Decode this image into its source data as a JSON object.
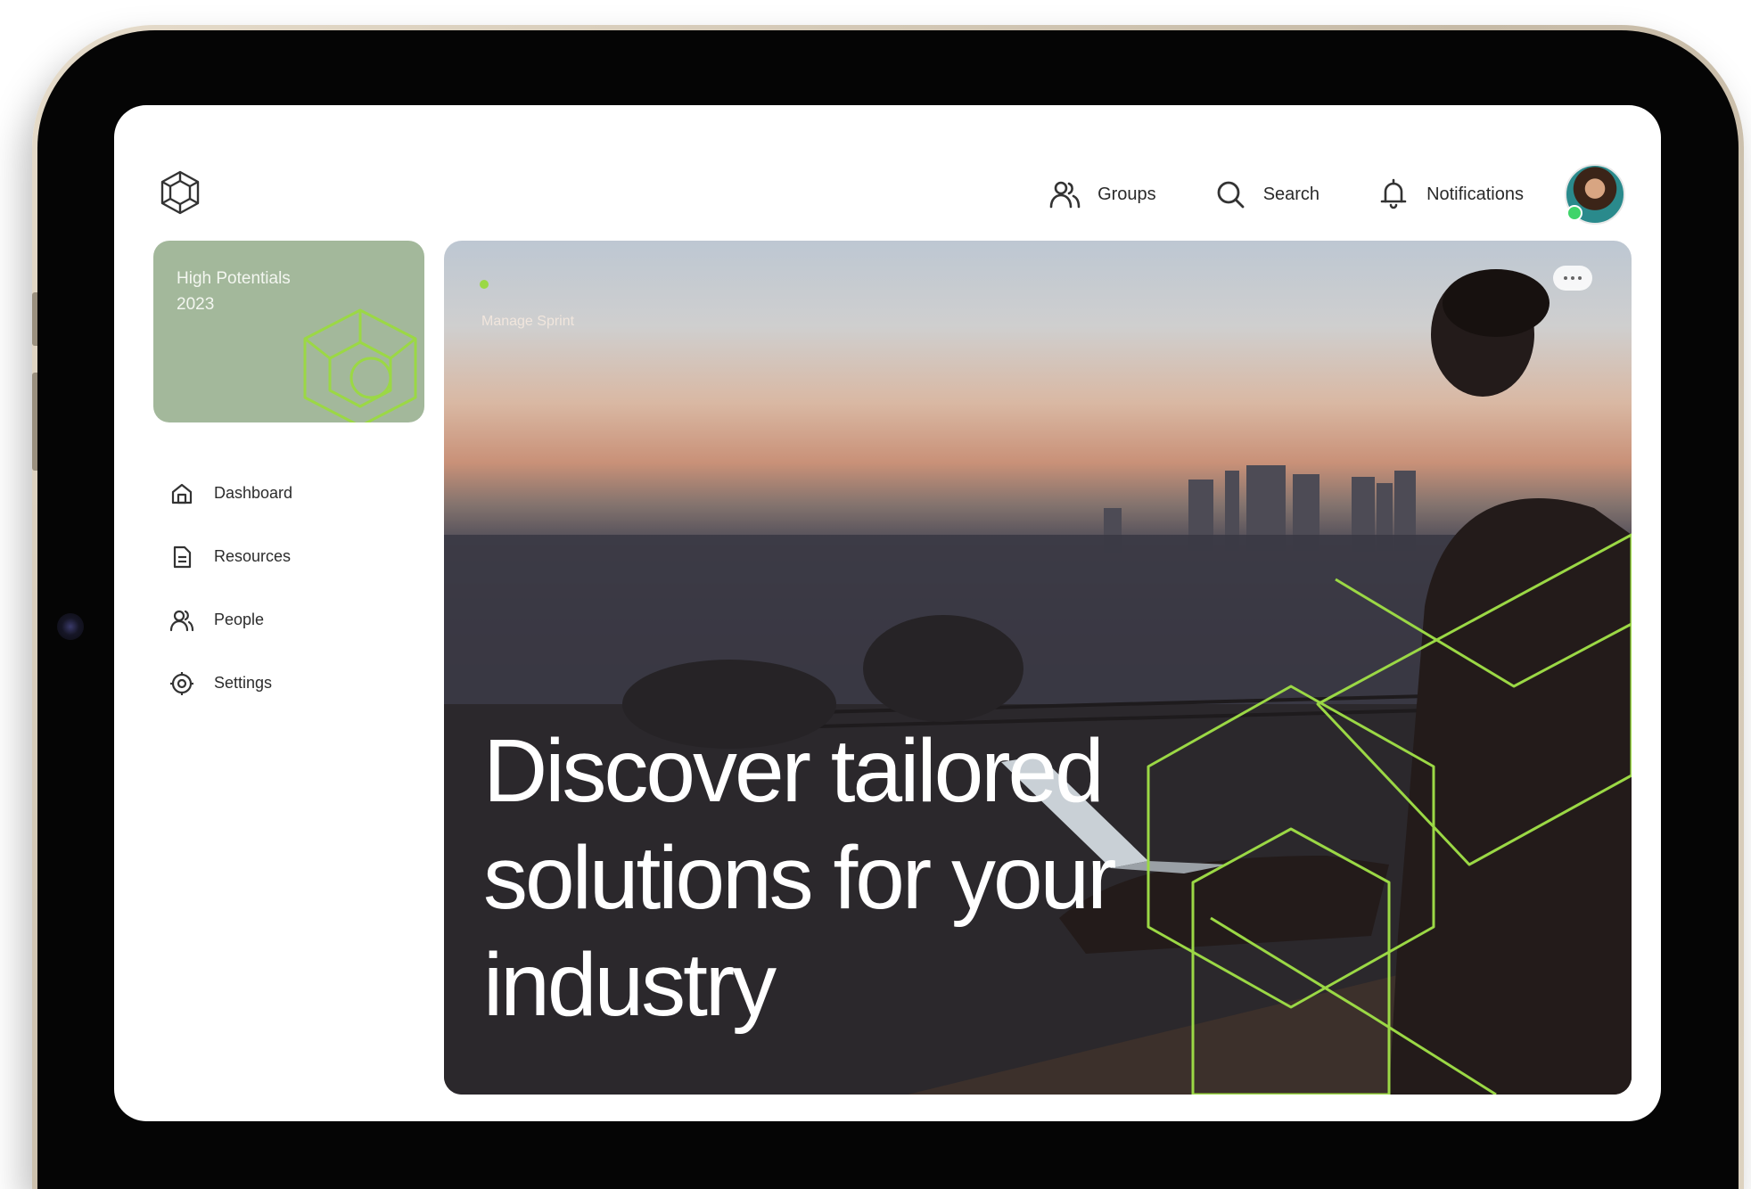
{
  "header": {
    "nav": [
      {
        "id": "groups",
        "label": "Groups",
        "icon": "groups-icon"
      },
      {
        "id": "search",
        "label": "Search",
        "icon": "search-icon"
      },
      {
        "id": "notifications",
        "label": "Notifications",
        "icon": "bell-icon"
      }
    ],
    "user": {
      "status": "online",
      "status_color": "#3fd46a"
    }
  },
  "sidebar": {
    "program_card": {
      "title": "High Potentials 2023",
      "color": "#a3b89b"
    },
    "items": [
      {
        "label": "Dashboard",
        "icon": "home-icon"
      },
      {
        "label": "Resources",
        "icon": "document-icon"
      },
      {
        "label": "People",
        "icon": "people-icon"
      },
      {
        "label": "Settings",
        "icon": "gear-icon"
      }
    ]
  },
  "hero": {
    "label": "Manage Sprint",
    "headline": "Discover tailored solutions for your industry",
    "accent_color": "#9bd845"
  },
  "colors": {
    "accent": "#9bd845",
    "text": "#2a2a2a"
  }
}
